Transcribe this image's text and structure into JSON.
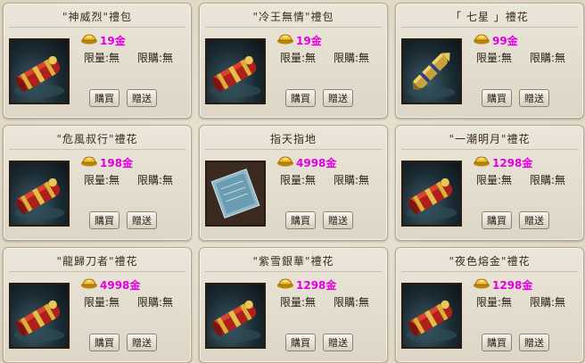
{
  "shop": {
    "labels": {
      "limit_qty": "限量:無",
      "limit_buy": "限購:無",
      "buy": "購買",
      "gift": "贈送"
    },
    "items": [
      {
        "name": "\"神威烈\"禮包",
        "price": "19金",
        "image": "red-gold-package-icon"
      },
      {
        "name": "\"冷王無情\"禮包",
        "price": "19金",
        "image": "red-gold-package-icon"
      },
      {
        "name": "「 七星 」禮花",
        "price": "99金",
        "image": "golden-firework-icon"
      },
      {
        "name": "\"危風叔行\"禮花",
        "price": "198金",
        "image": "red-gold-package-icon"
      },
      {
        "name": "指天指地",
        "price": "4998金",
        "image": "blue-scroll-icon"
      },
      {
        "name": "\"一潮明月\"禮花",
        "price": "1298金",
        "image": "red-gold-package-icon"
      },
      {
        "name": "\"龍歸刀者\"禮花",
        "price": "4998金",
        "image": "red-gold-package-icon"
      },
      {
        "name": "\"紫雪銀華\"禮花",
        "price": "1298金",
        "image": "red-gold-package-icon"
      },
      {
        "name": "\"夜色熔金\"禮花",
        "price": "1298金",
        "image": "red-gold-package-icon"
      }
    ]
  },
  "colors": {
    "price": "#e100e1",
    "card_bg": "#e6e0d2",
    "page_bg": "#e4dccb"
  }
}
